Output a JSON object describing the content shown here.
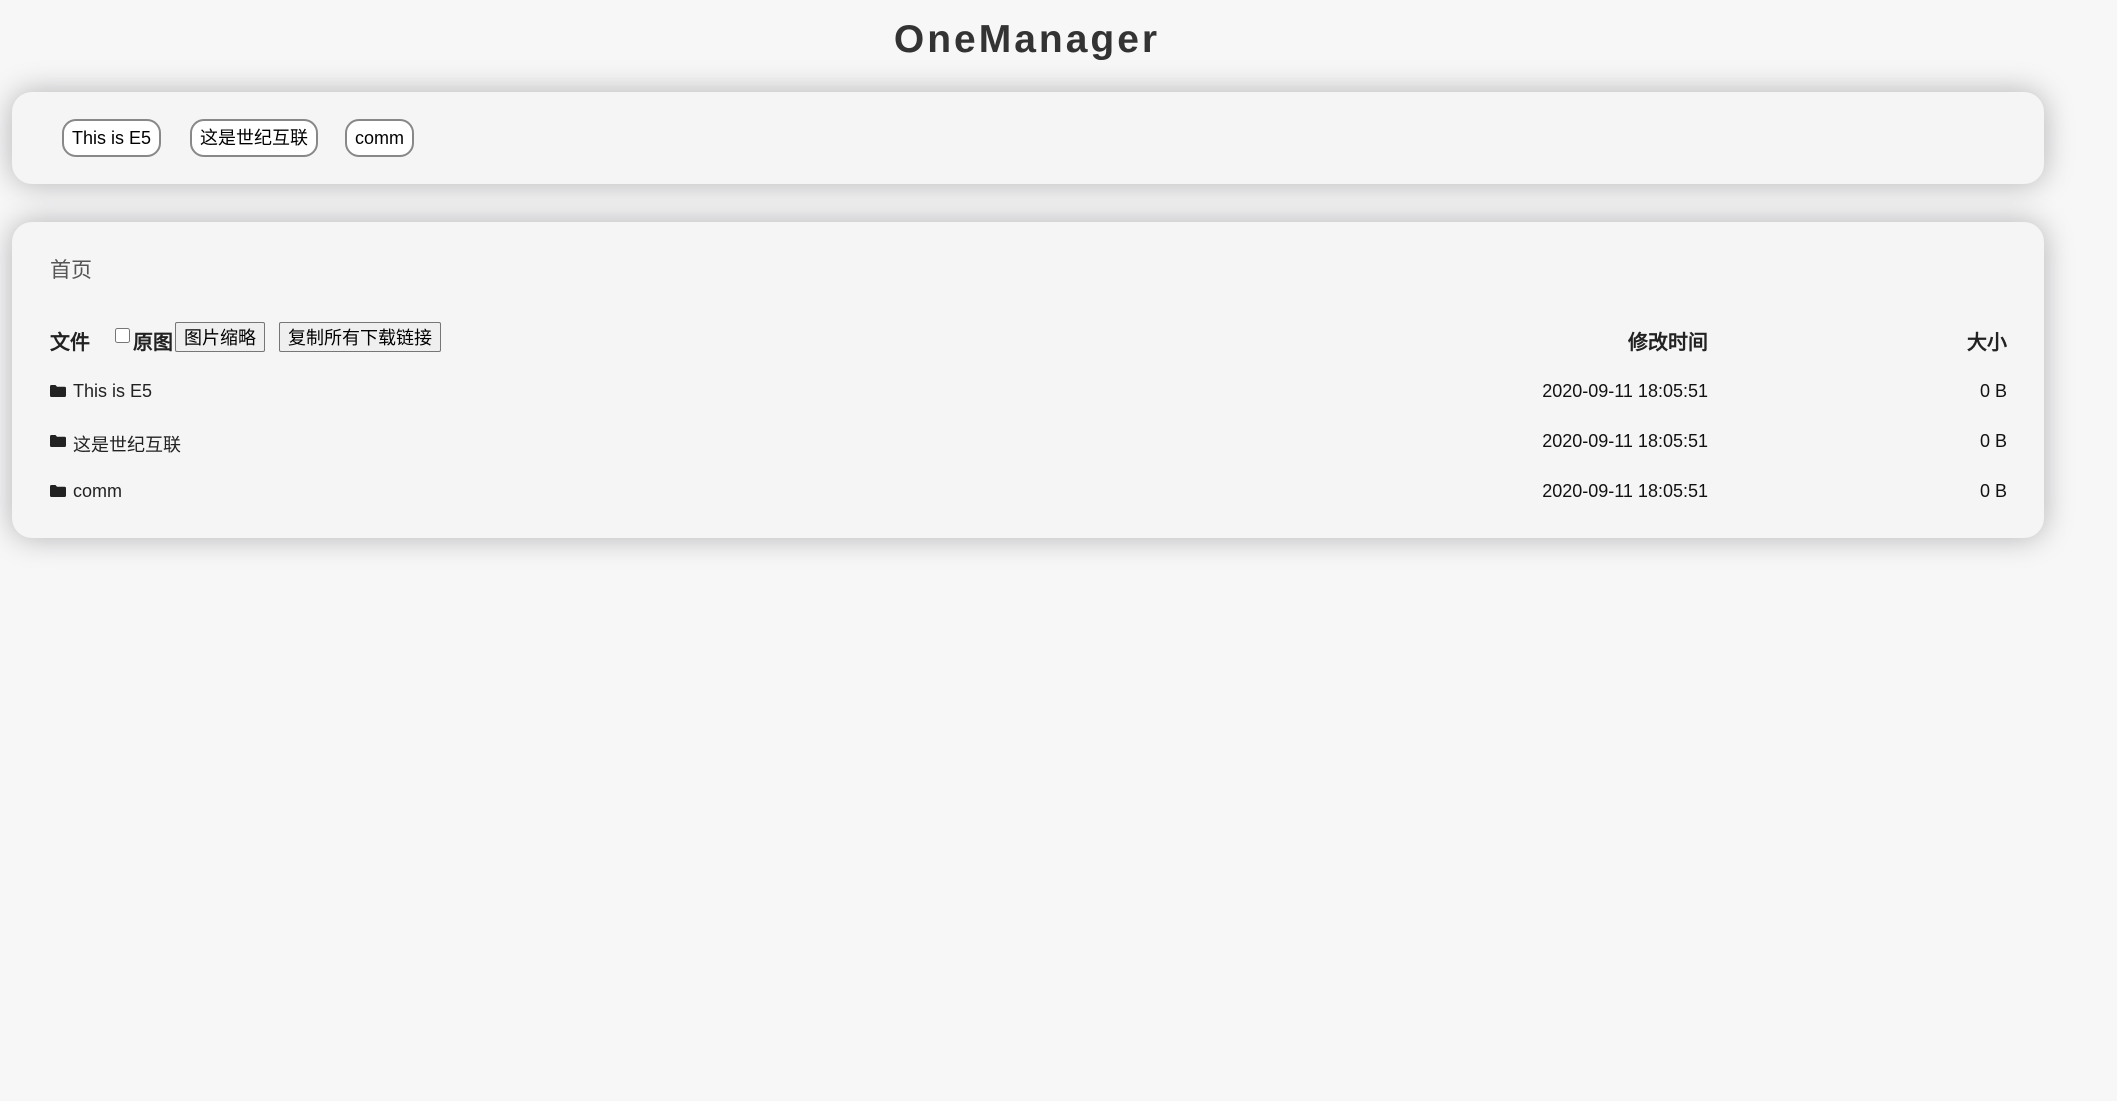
{
  "app": {
    "title": "OneManager"
  },
  "nav": {
    "items": [
      {
        "label": "This is E5"
      },
      {
        "label": "这是世纪互联"
      },
      {
        "label": "comm"
      }
    ]
  },
  "breadcrumb": {
    "home": "首页"
  },
  "table": {
    "headers": {
      "file": "文件",
      "original": "原图",
      "modified": "修改时间",
      "size": "大小"
    },
    "buttons": {
      "thumbnail": "图片缩略",
      "copy_links": "复制所有下载链接"
    },
    "rows": [
      {
        "icon": "folder-icon",
        "name": "This is E5",
        "modified": "2020-09-11 18:05:51",
        "size": "0 B"
      },
      {
        "icon": "folder-icon",
        "name": "这是世纪互联",
        "modified": "2020-09-11 18:05:51",
        "size": "0 B"
      },
      {
        "icon": "folder-icon",
        "name": "comm",
        "modified": "2020-09-11 18:05:51",
        "size": "0 B"
      }
    ]
  }
}
